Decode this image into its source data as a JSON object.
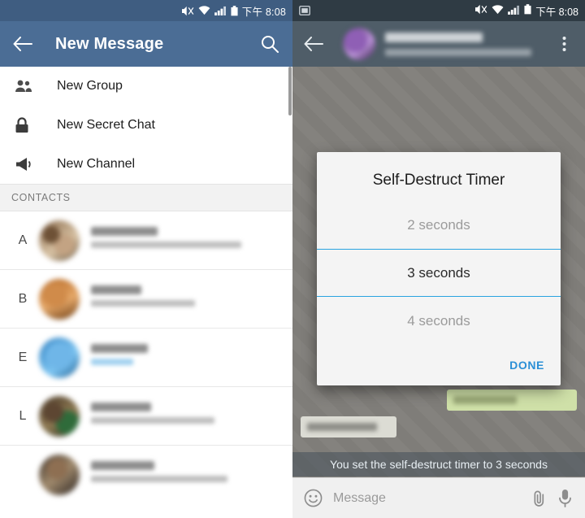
{
  "left": {
    "status": {
      "time": "下午 8:08",
      "icons": [
        "mute-icon",
        "wifi-icon",
        "signal-icon",
        "battery-icon"
      ]
    },
    "appbar": {
      "back_icon": "back-arrow-icon",
      "title": "New Message",
      "search_icon": "search-icon"
    },
    "menu": [
      {
        "label": "New Group",
        "icon": "group-icon"
      },
      {
        "label": "New Secret Chat",
        "icon": "lock-icon"
      },
      {
        "label": "New Channel",
        "icon": "megaphone-icon"
      }
    ],
    "contacts_header": "CONTACTS",
    "contacts": [
      {
        "letter": "A",
        "avatar": "av1"
      },
      {
        "letter": "B",
        "avatar": "av2"
      },
      {
        "letter": "E",
        "avatar": "av3",
        "sub_highlight": true
      },
      {
        "letter": "L",
        "avatar": "av4"
      },
      {
        "letter": "",
        "avatar": "av5"
      }
    ]
  },
  "right": {
    "status": {
      "time": "下午 8:08",
      "left_icon": "screenshot-icon",
      "icons": [
        "mute-icon",
        "wifi-icon",
        "signal-icon",
        "battery-icon"
      ]
    },
    "appbar": {
      "back_icon": "back-arrow-icon",
      "overflow_icon": "more-vert-icon"
    },
    "dialog": {
      "title": "Self-Destruct Timer",
      "options": [
        {
          "label": "2 seconds",
          "selected": false
        },
        {
          "label": "3 seconds",
          "selected": true
        },
        {
          "label": "4 seconds",
          "selected": false
        }
      ],
      "done_label": "DONE",
      "accent": "#29a3e0",
      "done_color": "#2b8fd6"
    },
    "service_message": "You set the self-destruct timer to 3 seconds",
    "composer": {
      "emoji_icon": "emoji-icon",
      "placeholder": "Message",
      "attach_icon": "paperclip-icon",
      "mic_icon": "microphone-icon"
    }
  }
}
